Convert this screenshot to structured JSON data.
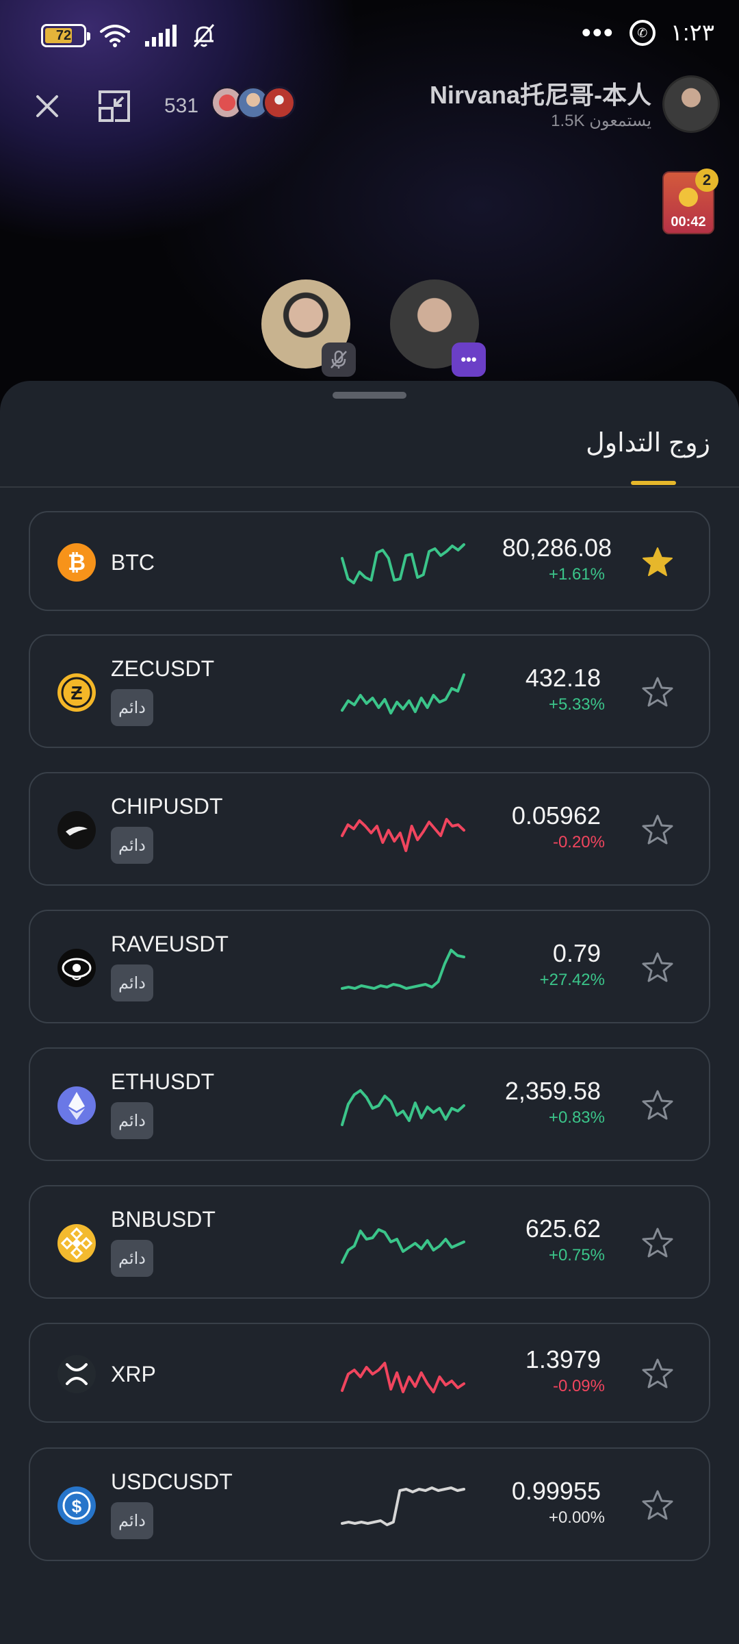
{
  "status_bar": {
    "battery": "72",
    "time": "١:٢٣",
    "overflow": "•••"
  },
  "live": {
    "viewer_count": "531",
    "host_name": "Nirvana托尼哥-本人",
    "host_listeners": "1.5K يستمعون",
    "gift_count": "2",
    "gift_timer": "00:42",
    "guest_more": "•••",
    "icons": {
      "close": "close-icon",
      "minimize": "minimize-window-icon",
      "mute": "mic-muted-icon"
    }
  },
  "sheet": {
    "tab_label": "زوج التداول"
  },
  "pairs": [
    {
      "symbol": "BTC",
      "tag": "",
      "price": "80,286.08",
      "change": "+1.61%",
      "trend": "up",
      "favorite": true,
      "icon": "bitcoin-icon",
      "color": "#f7931a",
      "spark": [
        30,
        60,
        66,
        50,
        58,
        62,
        22,
        18,
        30,
        62,
        60,
        26,
        24,
        58,
        54,
        20,
        16,
        26,
        20,
        12,
        18,
        10
      ]
    },
    {
      "symbol": "ZECUSDT",
      "tag": "دائم",
      "price": "432.18",
      "change": "+5.33%",
      "trend": "up",
      "favorite": false,
      "icon": "zcash-icon",
      "color": "#f4b728",
      "spark": [
        62,
        48,
        54,
        40,
        52,
        44,
        58,
        46,
        66,
        50,
        60,
        48,
        64,
        44,
        58,
        40,
        50,
        46,
        30,
        34,
        10
      ]
    },
    {
      "symbol": "CHIPUSDT",
      "tag": "دائم",
      "price": "0.05962",
      "change": "-0.20%",
      "trend": "down",
      "favorite": false,
      "icon": "chip-icon",
      "color": "#111111",
      "spark": [
        44,
        28,
        34,
        22,
        30,
        40,
        30,
        54,
        36,
        52,
        40,
        66,
        30,
        50,
        38,
        24,
        34,
        44,
        20,
        30,
        28,
        36
      ]
    },
    {
      "symbol": "RAVEUSDT",
      "tag": "دائم",
      "price": "0.79",
      "change": "+27.42%",
      "trend": "up",
      "favorite": false,
      "icon": "rave-eye-icon",
      "color": "#0b0b0b",
      "spark": [
        66,
        64,
        66,
        62,
        64,
        66,
        62,
        64,
        60,
        62,
        66,
        64,
        62,
        60,
        64,
        56,
        30,
        10,
        18,
        20
      ]
    },
    {
      "symbol": "ETHUSDT",
      "tag": "دائم",
      "price": "2,359.58",
      "change": "+0.83%",
      "trend": "up",
      "favorite": false,
      "icon": "ethereum-icon",
      "color": "#6a78e6",
      "spark": [
        64,
        34,
        20,
        14,
        24,
        40,
        36,
        22,
        30,
        50,
        44,
        58,
        32,
        54,
        38,
        46,
        40,
        56,
        40,
        44,
        36
      ]
    },
    {
      "symbol": "BNBUSDT",
      "tag": "دائم",
      "price": "625.62",
      "change": "+0.75%",
      "trend": "up",
      "favorite": false,
      "icon": "bnb-icon",
      "color": "#f3ba2f",
      "spark": [
        64,
        46,
        40,
        18,
        30,
        28,
        16,
        20,
        34,
        30,
        48,
        42,
        36,
        44,
        32,
        46,
        40,
        30,
        42,
        38,
        34
      ]
    },
    {
      "symbol": "XRP",
      "tag": "",
      "price": "1.3979",
      "change": "-0.09%",
      "trend": "down",
      "favorite": false,
      "icon": "xrp-icon",
      "color": "#23292f",
      "spark": [
        60,
        36,
        30,
        40,
        26,
        36,
        30,
        20,
        58,
        34,
        62,
        40,
        54,
        34,
        50,
        62,
        40,
        52,
        46,
        56,
        50
      ]
    },
    {
      "symbol": "USDCUSDT",
      "tag": "دائم",
      "price": "0.99955",
      "change": "+0.00%",
      "trend": "flat",
      "favorite": false,
      "icon": "usdc-icon",
      "color": "#2775ca",
      "spark": [
        62,
        60,
        62,
        60,
        62,
        60,
        58,
        64,
        60,
        14,
        12,
        16,
        12,
        14,
        10,
        14,
        12,
        10,
        14,
        12
      ]
    }
  ],
  "colors": {
    "up": "#3bc58a",
    "down": "#f0455e",
    "flat": "#d6d6d6",
    "accent": "#e6b72b",
    "sheet": "#1e232b"
  }
}
